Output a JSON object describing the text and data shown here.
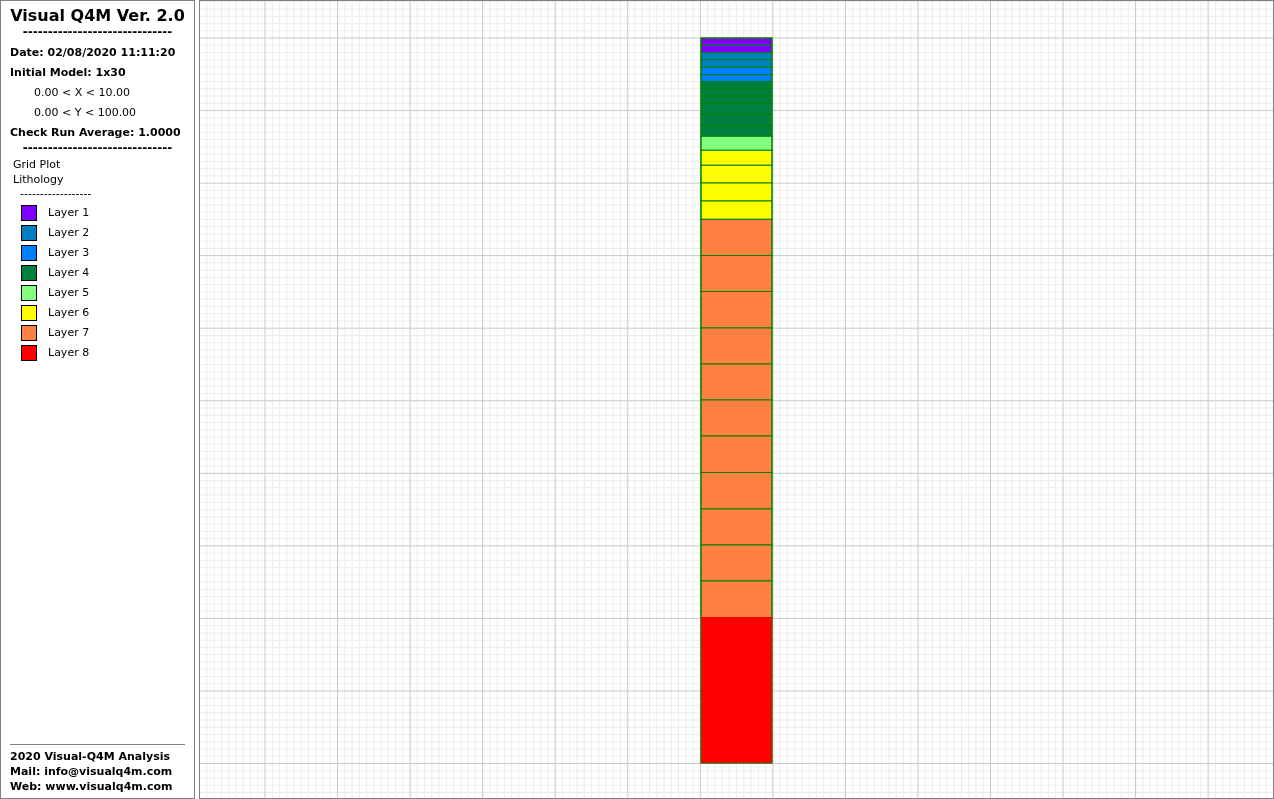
{
  "sidebar": {
    "title": "Visual Q4M Ver. 2.0",
    "divider": "------------------------------",
    "date": "Date: 02/08/2020 11:11:20",
    "model": "Initial Model: 1x30",
    "ranges": [
      "0.00 < X < 10.00",
      "0.00 < Y < 100.00"
    ],
    "average": "Check Run Average: 1.0000",
    "divider2": "------------------------------",
    "plot_items": [
      "Grid Plot",
      "Lithology"
    ],
    "legend_divider": "------------------",
    "legend": [
      {
        "label": "Layer 1",
        "color": "#8000ff"
      },
      {
        "label": "Layer 2",
        "color": "#0080c0"
      },
      {
        "label": "Layer 3",
        "color": "#0080ff"
      },
      {
        "label": "Layer 4",
        "color": "#008040"
      },
      {
        "label": "Layer 5",
        "color": "#80ff80"
      },
      {
        "label": "Layer 6",
        "color": "#ffff00"
      },
      {
        "label": "Layer 7",
        "color": "#ff8040"
      },
      {
        "label": "Layer 8",
        "color": "#ff0000"
      }
    ],
    "footer": [
      "2020 Visual-Q4M Analysis",
      "Mail: info@visualq4m.com",
      "Web: www.visualq4m.com"
    ]
  },
  "model_column": {
    "cells": [
      {
        "color": "#8000ff"
      },
      {
        "color": "#8000ff"
      },
      {
        "color": "#0080c0"
      },
      {
        "color": "#0080c0"
      },
      {
        "color": "#0080ff"
      },
      {
        "color": "#0080ff"
      },
      {
        "color": "#008040"
      },
      {
        "color": "#008040"
      },
      {
        "color": "#008040"
      },
      {
        "color": "#008040"
      },
      {
        "color": "#008040"
      },
      {
        "color": "#008040"
      },
      {
        "color": "#80ff80"
      },
      {
        "color": "#ffff00"
      },
      {
        "color": "#ffff00"
      },
      {
        "color": "#ffff00"
      },
      {
        "color": "#ffff00"
      },
      {
        "color": "#ff8040"
      },
      {
        "color": "#ff8040"
      },
      {
        "color": "#ff8040"
      },
      {
        "color": "#ff8040"
      },
      {
        "color": "#ff8040"
      },
      {
        "color": "#ff8040"
      },
      {
        "color": "#ff8040"
      },
      {
        "color": "#ff8040"
      },
      {
        "color": "#ff8040"
      },
      {
        "color": "#ff8040"
      },
      {
        "color": "#ff8040"
      },
      {
        "color": "#ff0000"
      },
      {
        "color": "#ff0000"
      }
    ]
  }
}
